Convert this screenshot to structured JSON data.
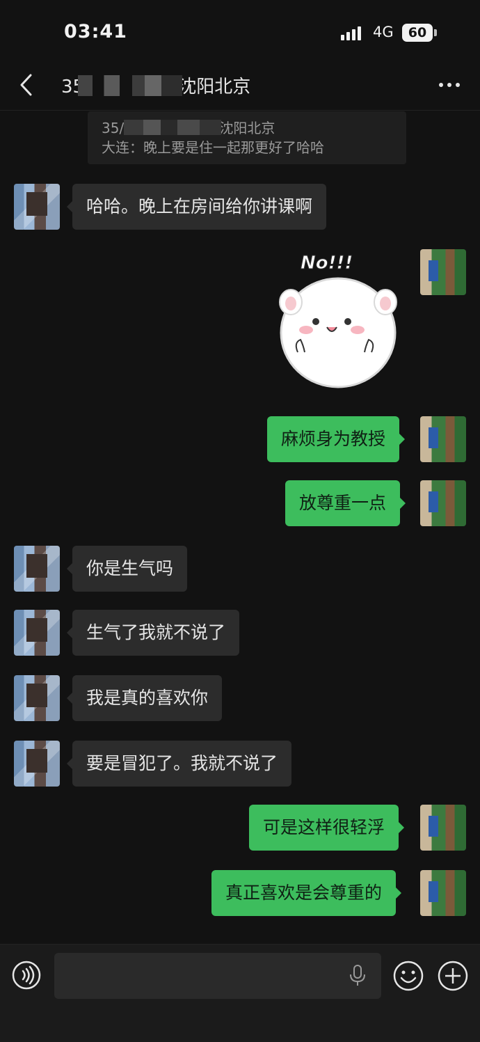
{
  "status_bar": {
    "time": "03:41",
    "network": "4G",
    "battery": "60"
  },
  "header": {
    "title": "35/150北京...沈阳北京",
    "back_icon": "chevron-left-icon",
    "more_icon": "more-dots-icon"
  },
  "quote": {
    "line1": "35/150北京...教授沈阳北京",
    "line2": "大连：晚上要是住一起那更好了哈哈"
  },
  "messages": [
    {
      "side": "in",
      "text": "哈哈。晚上在房间给你讲课啊"
    },
    {
      "side": "out",
      "type": "sticker",
      "sticker_text": "No!!!"
    },
    {
      "side": "out",
      "text": "麻烦身为教授"
    },
    {
      "side": "out",
      "text": "放尊重一点"
    },
    {
      "side": "in",
      "text": "你是生气吗"
    },
    {
      "side": "in",
      "text": "生气了我就不说了"
    },
    {
      "side": "in",
      "text": "我是真的喜欢你"
    },
    {
      "side": "in",
      "text": "要是冒犯了。我就不说了"
    },
    {
      "side": "out",
      "text": "可是这样很轻浮"
    },
    {
      "side": "out",
      "text": "真正喜欢是会尊重的"
    }
  ],
  "input_bar": {
    "placeholder": "",
    "voice_icon": "voice-wave-icon",
    "mic_icon": "microphone-icon",
    "emoji_icon": "smiley-icon",
    "plus_icon": "plus-circle-icon"
  },
  "colors": {
    "bubble_out": "#3dbd5d",
    "bubble_in": "#2c2c2c",
    "background": "#121212"
  }
}
